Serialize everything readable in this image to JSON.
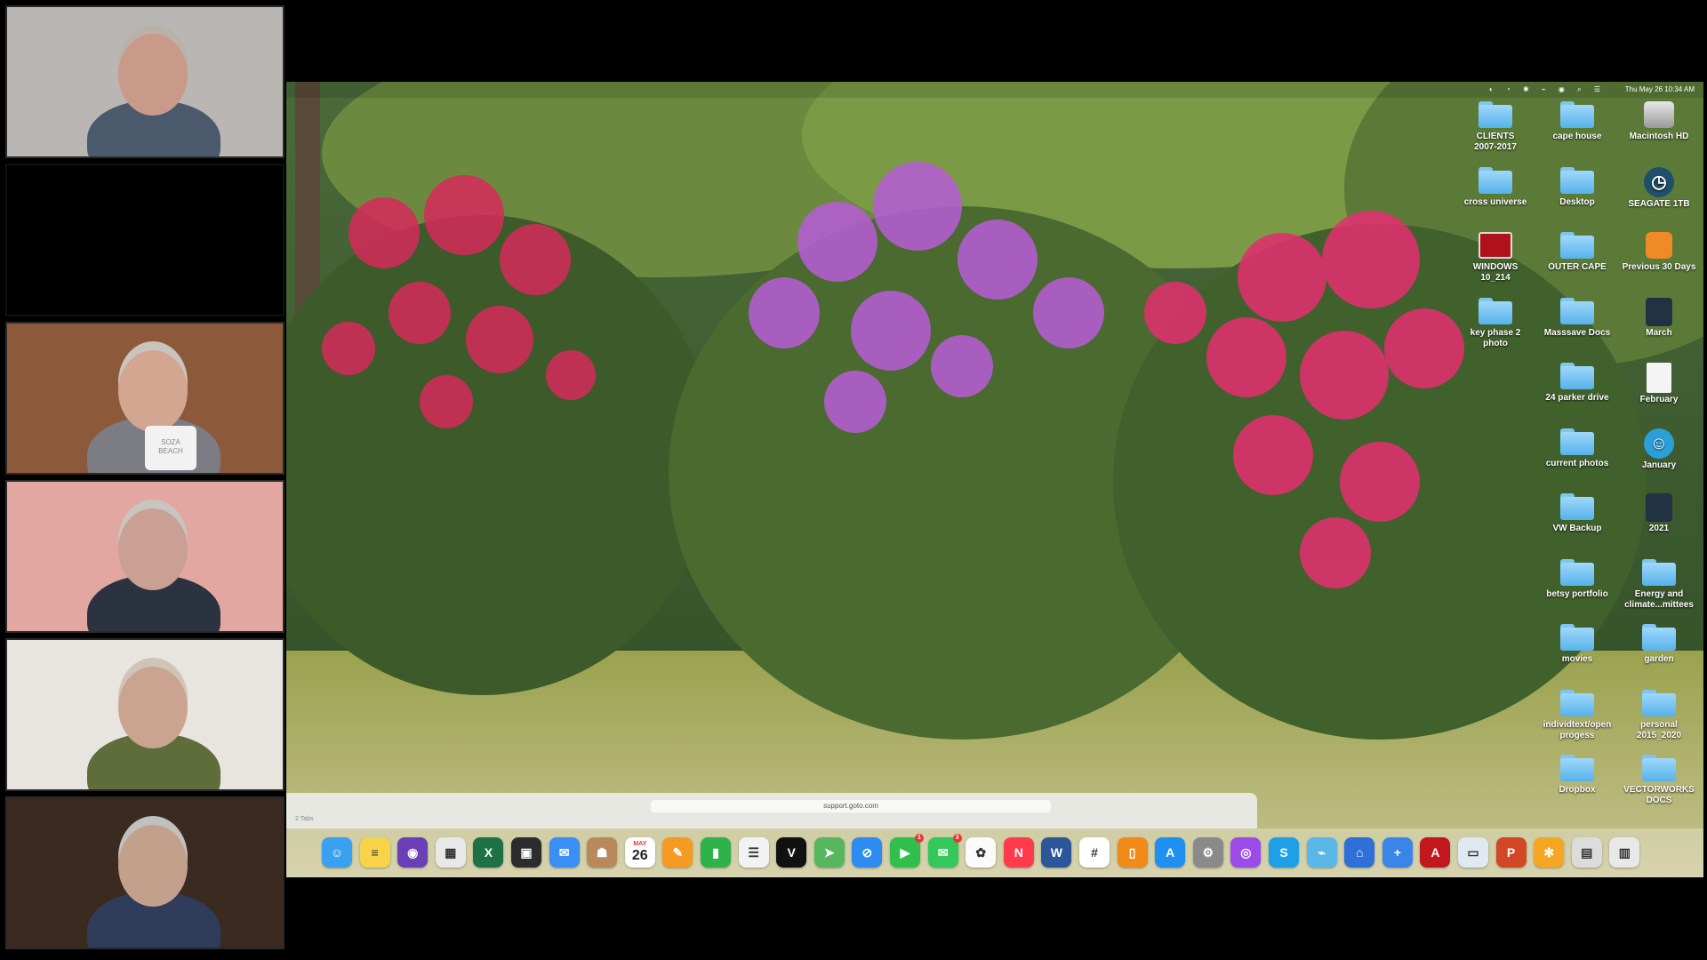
{
  "participants": [
    {
      "name": "",
      "skin": "#c9998a",
      "hair": "#b8b2a8",
      "bg": "#b9b6b3",
      "shirt": "#4a5a6c"
    },
    {
      "name": "",
      "skin": "#000000",
      "hair": "#000000",
      "bg": "#000000",
      "shirt": "#000000"
    },
    {
      "name": "",
      "skin": "#d2a690",
      "hair": "#c9c4bd",
      "bg": "#8c5a3a",
      "shirt": "#7c7c84",
      "mug_text": "SOZA\nBEACH"
    },
    {
      "name": "",
      "skin": "#c9a093",
      "hair": "#c8c4c0",
      "bg": "#e2a7a0",
      "shirt": "#2b3340"
    },
    {
      "name": "",
      "skin": "#caa491",
      "hair": "#cfc4b6",
      "bg": "#e8e5e0",
      "shirt": "#5f6d3a"
    },
    {
      "name": "",
      "skin": "#c2a08c",
      "hair": "#c0c0c0",
      "bg": "#3b2a20",
      "shirt": "#2f3d5a"
    }
  ],
  "menubar": {
    "clock": "Thu May 26  10:34 AM"
  },
  "desktop_icons": [
    {
      "label": "CLIENTS\n2007-2017",
      "type": "folder",
      "col": 0,
      "row": 0
    },
    {
      "label": "cape house",
      "type": "folder",
      "col": 1,
      "row": 0
    },
    {
      "label": "Macintosh HD",
      "type": "drive",
      "col": 2,
      "row": 0
    },
    {
      "label": "cross universe",
      "type": "folder",
      "col": 0,
      "row": 1
    },
    {
      "label": "Desktop",
      "type": "folder",
      "col": 1,
      "row": 1
    },
    {
      "label": "SEAGATE 1TB",
      "type": "timemachine",
      "col": 2,
      "row": 1
    },
    {
      "label": "WINDOWS\n10_214",
      "type": "red",
      "col": 0,
      "row": 2
    },
    {
      "label": "OUTER CAPE",
      "type": "folder",
      "col": 1,
      "row": 2
    },
    {
      "label": "Previous 30 Days",
      "type": "orange",
      "col": 2,
      "row": 2
    },
    {
      "label": "key phase 2\nphoto",
      "type": "folder",
      "col": 0,
      "row": 3
    },
    {
      "label": "Masssave Docs",
      "type": "folder",
      "col": 1,
      "row": 3
    },
    {
      "label": "March",
      "type": "dark",
      "col": 2,
      "row": 3
    },
    {
      "label": "24 parker drive",
      "type": "folder",
      "col": 1,
      "row": 4
    },
    {
      "label": "February",
      "type": "doc",
      "col": 2,
      "row": 4
    },
    {
      "label": "current photos",
      "type": "folder",
      "col": 1,
      "row": 5
    },
    {
      "label": "January",
      "type": "round",
      "col": 2,
      "row": 5
    },
    {
      "label": "VW Backup",
      "type": "folder",
      "col": 1,
      "row": 6
    },
    {
      "label": "2021",
      "type": "dark",
      "col": 2,
      "row": 6
    },
    {
      "label": "betsy portfolio",
      "type": "folder",
      "col": 1,
      "row": 7
    },
    {
      "label": "Energy and\nclimate...mittees",
      "type": "folder",
      "col": 2,
      "row": 7
    },
    {
      "label": "movies",
      "type": "folder",
      "col": 1,
      "row": 8
    },
    {
      "label": "garden",
      "type": "folder",
      "col": 2,
      "row": 8
    },
    {
      "label": "individtext/open\nprogess",
      "type": "folder",
      "col": 1,
      "row": 9
    },
    {
      "label": "personal\n2015_2020",
      "type": "folder",
      "col": 2,
      "row": 9
    },
    {
      "label": "Dropbox",
      "type": "folder",
      "col": 1,
      "row": 10
    },
    {
      "label": "VECTORWORKS\nDOCS",
      "type": "folder",
      "col": 2,
      "row": 10
    }
  ],
  "safari": {
    "url": "support.goto.com",
    "tabs_label": "2 Tabs"
  },
  "dock": {
    "calendar_month": "MAY",
    "calendar_day": "26",
    "apps": [
      {
        "name": "finder-icon",
        "color": "#3aa0f0",
        "glyph": "☺"
      },
      {
        "name": "notes-icon",
        "color": "#f7d34a",
        "glyph": "≡"
      },
      {
        "name": "siri-icon",
        "color": "#6b3fb8",
        "glyph": "◉"
      },
      {
        "name": "launchpad-icon",
        "color": "#e8e8e8",
        "glyph": "▦"
      },
      {
        "name": "excel-icon",
        "color": "#1e7145",
        "glyph": "X"
      },
      {
        "name": "mission-control-icon",
        "color": "#2c2c2c",
        "glyph": "▣"
      },
      {
        "name": "mail-icon",
        "color": "#3a8ef5",
        "glyph": "✉"
      },
      {
        "name": "contacts-icon",
        "color": "#b8895a",
        "glyph": "☗"
      },
      {
        "name": "calendar-icon",
        "color": "#ffffff",
        "glyph": ""
      },
      {
        "name": "pages-icon",
        "color": "#f59a23",
        "glyph": "✎"
      },
      {
        "name": "numbers-icon",
        "color": "#2fb24a",
        "glyph": "▮"
      },
      {
        "name": "reminders-icon",
        "color": "#f2f2f2",
        "glyph": "☰"
      },
      {
        "name": "vectorworks-icon",
        "color": "#111111",
        "glyph": "V"
      },
      {
        "name": "maps-icon",
        "color": "#58b75e",
        "glyph": "➤"
      },
      {
        "name": "safari-icon",
        "color": "#2d8cf0",
        "glyph": "⊘"
      },
      {
        "name": "facetime-icon",
        "color": "#2fbf4a",
        "glyph": "▶",
        "badge": "1"
      },
      {
        "name": "messages-icon",
        "color": "#34c759",
        "glyph": "✉",
        "badge": "3"
      },
      {
        "name": "photos-icon",
        "color": "#fafafa",
        "glyph": "✿"
      },
      {
        "name": "news-icon",
        "color": "#ff3b4c",
        "glyph": "N"
      },
      {
        "name": "word-icon",
        "color": "#2b579a",
        "glyph": "W"
      },
      {
        "name": "slack-icon",
        "color": "#ffffff",
        "glyph": "#"
      },
      {
        "name": "books-icon",
        "color": "#f28a1a",
        "glyph": "▯"
      },
      {
        "name": "app-store-icon",
        "color": "#1f8ff0",
        "glyph": "A"
      },
      {
        "name": "system-preferences-icon",
        "color": "#8a8a8a",
        "glyph": "⚙"
      },
      {
        "name": "podcasts-icon",
        "color": "#9b4be8",
        "glyph": "◎"
      },
      {
        "name": "skype-icon",
        "color": "#1ea0e8",
        "glyph": "S"
      },
      {
        "name": "network-utility-icon",
        "color": "#5ab8e8",
        "glyph": "⌁"
      },
      {
        "name": "webex-icon",
        "color": "#2f6fd8",
        "glyph": "⌂"
      },
      {
        "name": "screenshot-icon",
        "color": "#3a86e8",
        "glyph": "+"
      },
      {
        "name": "acrobat-icon",
        "color": "#c3171e",
        "glyph": "A"
      },
      {
        "name": "preview-icon",
        "color": "#e0e8f0",
        "glyph": "▭"
      },
      {
        "name": "powerpoint-icon",
        "color": "#d24726",
        "glyph": "P"
      },
      {
        "name": "gotomeeting-icon",
        "color": "#f5a623",
        "glyph": "✻"
      },
      {
        "name": "downloads-stack-icon",
        "color": "#dcdcdc",
        "glyph": "▤"
      },
      {
        "name": "trash-icon",
        "color": "#e8e8e8",
        "glyph": "▥"
      }
    ]
  }
}
